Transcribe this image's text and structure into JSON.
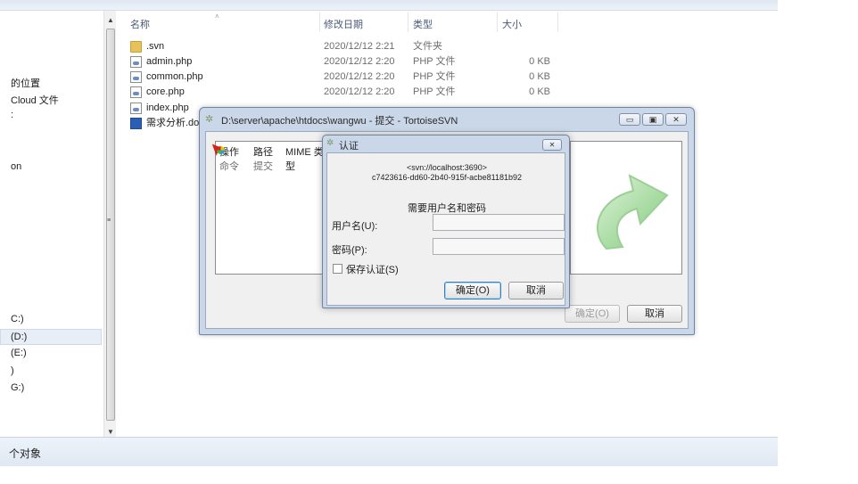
{
  "explorer": {
    "nav": {
      "items": [
        {
          "label": "的位置",
          "selected": false
        },
        {
          "label": "Cloud 文件",
          "selected": false
        },
        {
          "label": ":",
          "selected": false
        },
        {
          "label": "on",
          "selected": false
        },
        {
          "label": "C:)",
          "selected": false
        },
        {
          "label": "(D:)",
          "selected": true
        },
        {
          "label": "(E:)",
          "selected": false
        },
        {
          "label": ")",
          "selected": false
        },
        {
          "label": "G:)",
          "selected": false
        }
      ]
    },
    "columns": {
      "name": "名称",
      "date": "修改日期",
      "type": "类型",
      "size": "大小"
    },
    "files": [
      {
        "name": ".svn",
        "date": "2020/12/12 2:21",
        "type": "文件夹",
        "size": "",
        "icon": "folder-icon"
      },
      {
        "name": "admin.php",
        "date": "2020/12/12 2:20",
        "type": "PHP 文件",
        "size": "0 KB",
        "icon": "php-file-icon"
      },
      {
        "name": "common.php",
        "date": "2020/12/12 2:20",
        "type": "PHP 文件",
        "size": "0 KB",
        "icon": "php-file-icon"
      },
      {
        "name": "core.php",
        "date": "2020/12/12 2:20",
        "type": "PHP 文件",
        "size": "0 KB",
        "icon": "php-file-icon"
      },
      {
        "name": "index.php",
        "date": "",
        "type": "",
        "size": "",
        "icon": "php-file-icon"
      },
      {
        "name": "需求分析.doc",
        "date": "",
        "type": "",
        "size": "",
        "icon": "word-doc-icon"
      }
    ],
    "status": "个对象"
  },
  "commit_window": {
    "title": "D:\\server\\apache\\htdocs\\wangwu - 提交 - TortoiseSVN",
    "list_headers": [
      "操作",
      "路径",
      "MIME 类型"
    ],
    "list_row": [
      "命令",
      "提交"
    ],
    "ok_label": "确定(O)",
    "cancel_label": "取消"
  },
  "auth_dialog": {
    "title": "认证",
    "realm_line1": "<svn://localhost:3690>",
    "realm_line2": "c7423616-dd60-2b40-915f-acbe81181b92",
    "prompt": "需要用户名和密码",
    "username_label": "用户名(U):",
    "username_value": "",
    "password_label": "密码(P):",
    "password_value": "",
    "save_label": "保存认证(S)",
    "ok_label": "确定(O)",
    "cancel_label": "取消"
  },
  "colors": {
    "accent": "#3c7fb1",
    "window_frame": "#c9d7e8",
    "svn_arrow": "#7fc97a"
  }
}
